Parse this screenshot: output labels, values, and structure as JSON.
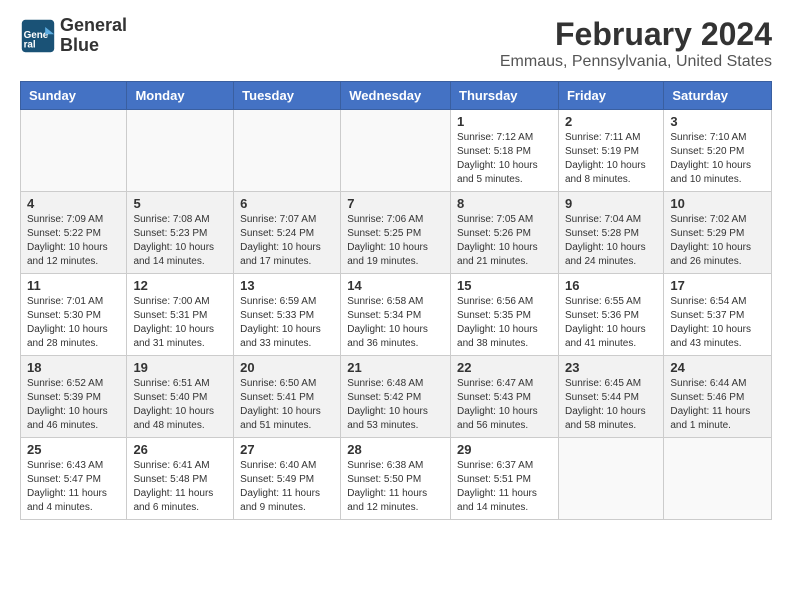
{
  "logo": {
    "line1": "General",
    "line2": "Blue"
  },
  "title": "February 2024",
  "subtitle": "Emmaus, Pennsylvania, United States",
  "days_of_week": [
    "Sunday",
    "Monday",
    "Tuesday",
    "Wednesday",
    "Thursday",
    "Friday",
    "Saturday"
  ],
  "weeks": [
    [
      {
        "day": "",
        "info": ""
      },
      {
        "day": "",
        "info": ""
      },
      {
        "day": "",
        "info": ""
      },
      {
        "day": "",
        "info": ""
      },
      {
        "day": "1",
        "info": "Sunrise: 7:12 AM\nSunset: 5:18 PM\nDaylight: 10 hours\nand 5 minutes."
      },
      {
        "day": "2",
        "info": "Sunrise: 7:11 AM\nSunset: 5:19 PM\nDaylight: 10 hours\nand 8 minutes."
      },
      {
        "day": "3",
        "info": "Sunrise: 7:10 AM\nSunset: 5:20 PM\nDaylight: 10 hours\nand 10 minutes."
      }
    ],
    [
      {
        "day": "4",
        "info": "Sunrise: 7:09 AM\nSunset: 5:22 PM\nDaylight: 10 hours\nand 12 minutes."
      },
      {
        "day": "5",
        "info": "Sunrise: 7:08 AM\nSunset: 5:23 PM\nDaylight: 10 hours\nand 14 minutes."
      },
      {
        "day": "6",
        "info": "Sunrise: 7:07 AM\nSunset: 5:24 PM\nDaylight: 10 hours\nand 17 minutes."
      },
      {
        "day": "7",
        "info": "Sunrise: 7:06 AM\nSunset: 5:25 PM\nDaylight: 10 hours\nand 19 minutes."
      },
      {
        "day": "8",
        "info": "Sunrise: 7:05 AM\nSunset: 5:26 PM\nDaylight: 10 hours\nand 21 minutes."
      },
      {
        "day": "9",
        "info": "Sunrise: 7:04 AM\nSunset: 5:28 PM\nDaylight: 10 hours\nand 24 minutes."
      },
      {
        "day": "10",
        "info": "Sunrise: 7:02 AM\nSunset: 5:29 PM\nDaylight: 10 hours\nand 26 minutes."
      }
    ],
    [
      {
        "day": "11",
        "info": "Sunrise: 7:01 AM\nSunset: 5:30 PM\nDaylight: 10 hours\nand 28 minutes."
      },
      {
        "day": "12",
        "info": "Sunrise: 7:00 AM\nSunset: 5:31 PM\nDaylight: 10 hours\nand 31 minutes."
      },
      {
        "day": "13",
        "info": "Sunrise: 6:59 AM\nSunset: 5:33 PM\nDaylight: 10 hours\nand 33 minutes."
      },
      {
        "day": "14",
        "info": "Sunrise: 6:58 AM\nSunset: 5:34 PM\nDaylight: 10 hours\nand 36 minutes."
      },
      {
        "day": "15",
        "info": "Sunrise: 6:56 AM\nSunset: 5:35 PM\nDaylight: 10 hours\nand 38 minutes."
      },
      {
        "day": "16",
        "info": "Sunrise: 6:55 AM\nSunset: 5:36 PM\nDaylight: 10 hours\nand 41 minutes."
      },
      {
        "day": "17",
        "info": "Sunrise: 6:54 AM\nSunset: 5:37 PM\nDaylight: 10 hours\nand 43 minutes."
      }
    ],
    [
      {
        "day": "18",
        "info": "Sunrise: 6:52 AM\nSunset: 5:39 PM\nDaylight: 10 hours\nand 46 minutes."
      },
      {
        "day": "19",
        "info": "Sunrise: 6:51 AM\nSunset: 5:40 PM\nDaylight: 10 hours\nand 48 minutes."
      },
      {
        "day": "20",
        "info": "Sunrise: 6:50 AM\nSunset: 5:41 PM\nDaylight: 10 hours\nand 51 minutes."
      },
      {
        "day": "21",
        "info": "Sunrise: 6:48 AM\nSunset: 5:42 PM\nDaylight: 10 hours\nand 53 minutes."
      },
      {
        "day": "22",
        "info": "Sunrise: 6:47 AM\nSunset: 5:43 PM\nDaylight: 10 hours\nand 56 minutes."
      },
      {
        "day": "23",
        "info": "Sunrise: 6:45 AM\nSunset: 5:44 PM\nDaylight: 10 hours\nand 58 minutes."
      },
      {
        "day": "24",
        "info": "Sunrise: 6:44 AM\nSunset: 5:46 PM\nDaylight: 11 hours\nand 1 minute."
      }
    ],
    [
      {
        "day": "25",
        "info": "Sunrise: 6:43 AM\nSunset: 5:47 PM\nDaylight: 11 hours\nand 4 minutes."
      },
      {
        "day": "26",
        "info": "Sunrise: 6:41 AM\nSunset: 5:48 PM\nDaylight: 11 hours\nand 6 minutes."
      },
      {
        "day": "27",
        "info": "Sunrise: 6:40 AM\nSunset: 5:49 PM\nDaylight: 11 hours\nand 9 minutes."
      },
      {
        "day": "28",
        "info": "Sunrise: 6:38 AM\nSunset: 5:50 PM\nDaylight: 11 hours\nand 12 minutes."
      },
      {
        "day": "29",
        "info": "Sunrise: 6:37 AM\nSunset: 5:51 PM\nDaylight: 11 hours\nand 14 minutes."
      },
      {
        "day": "",
        "info": ""
      },
      {
        "day": "",
        "info": ""
      }
    ]
  ]
}
